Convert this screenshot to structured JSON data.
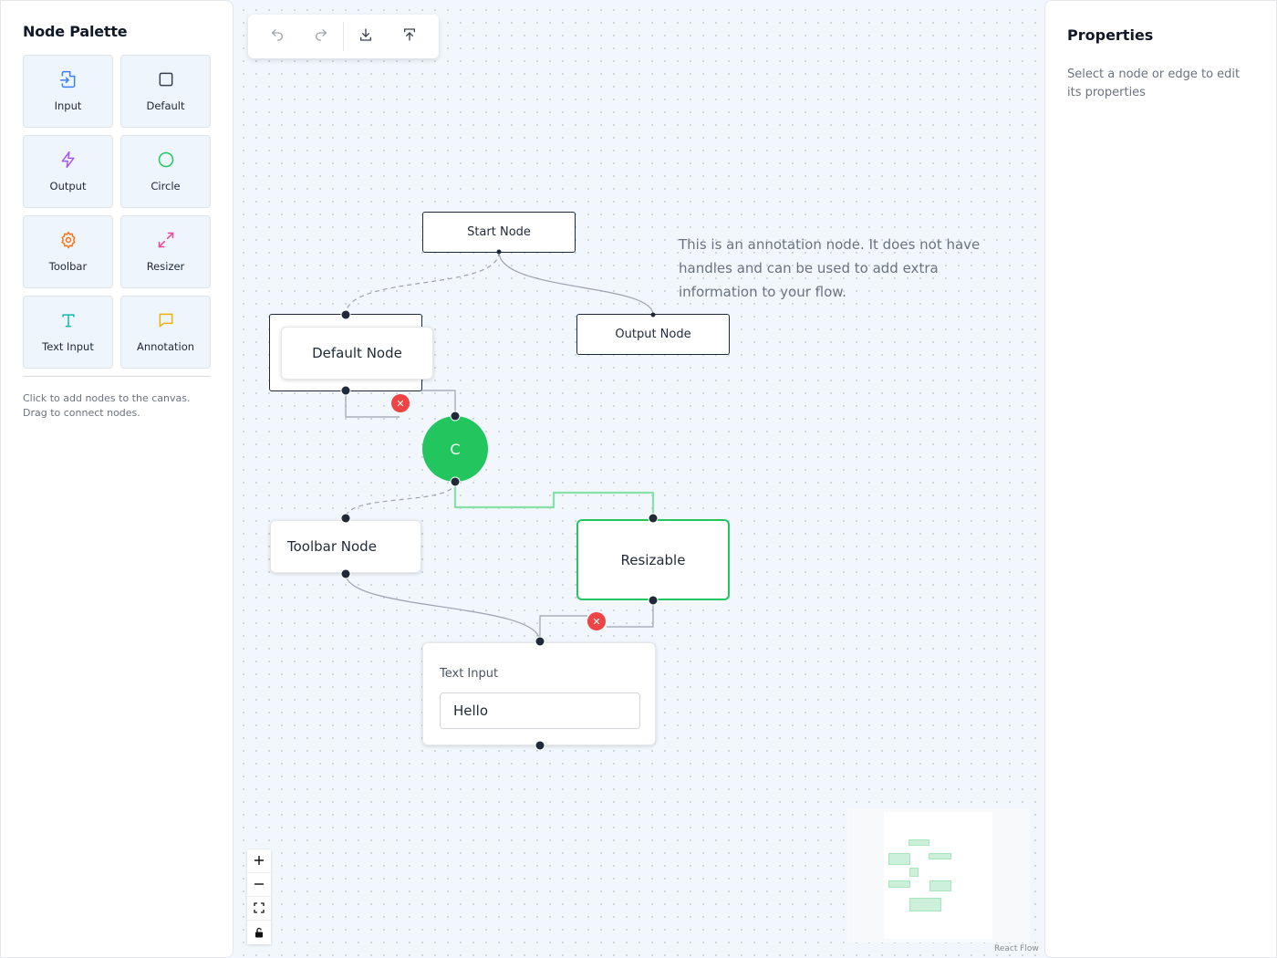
{
  "palette": {
    "title": "Node Palette",
    "items": [
      {
        "label": "Input",
        "icon": "input-icon",
        "color": "#3b82f6"
      },
      {
        "label": "Default",
        "icon": "square-icon",
        "color": "#374151"
      },
      {
        "label": "Output",
        "icon": "zap-icon",
        "color": "#a855f7"
      },
      {
        "label": "Circle",
        "icon": "circle-icon",
        "color": "#22c55e"
      },
      {
        "label": "Toolbar",
        "icon": "gear-icon",
        "color": "#f97316"
      },
      {
        "label": "Resizer",
        "icon": "resize-icon",
        "color": "#ec4899"
      },
      {
        "label": "Text Input",
        "icon": "type-icon",
        "color": "#14b8a6"
      },
      {
        "label": "Annotation",
        "icon": "message-icon",
        "color": "#eab308"
      }
    ],
    "help": "Click to add nodes to the canvas. Drag to connect nodes."
  },
  "properties": {
    "title": "Properties",
    "empty_text": "Select a node or edge to edit its properties"
  },
  "toolbar": {
    "undo": "undo-icon",
    "redo": "redo-icon",
    "download": "download-icon",
    "upload": "upload-icon"
  },
  "nodes": {
    "start": "Start Node",
    "output": "Output Node",
    "default": "Default Node",
    "circle": "C",
    "toolbar": "Toolbar Node",
    "resizable": "Resizable",
    "text_input": {
      "label": "Text Input",
      "value": "Hello"
    },
    "annotation": "This is an annotation node. It does not have handles and can be used to add extra information to your flow."
  },
  "edge_delete_symbol": "✕",
  "colors": {
    "accent_green": "#22c55e",
    "delete_red": "#ef4444",
    "canvas_bg": "#f1f7fd"
  },
  "attribution": "React Flow"
}
